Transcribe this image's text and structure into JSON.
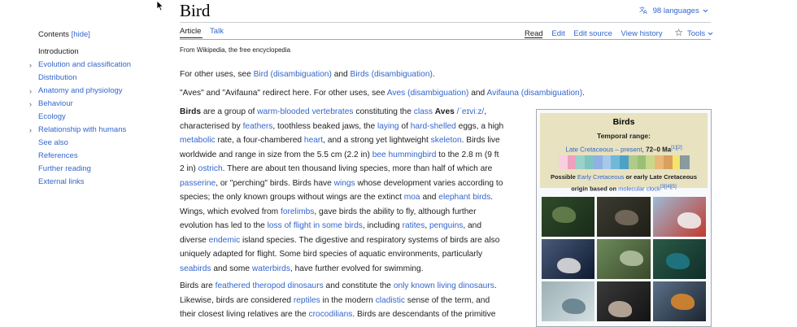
{
  "toc": {
    "header": "Contents",
    "hide": "[hide]",
    "items": [
      {
        "label": "Introduction",
        "current": true,
        "expand": false
      },
      {
        "label": "Evolution and classification",
        "current": false,
        "expand": true
      },
      {
        "label": "Distribution",
        "current": false,
        "expand": false
      },
      {
        "label": "Anatomy and physiology",
        "current": false,
        "expand": true
      },
      {
        "label": "Behaviour",
        "current": false,
        "expand": true
      },
      {
        "label": "Ecology",
        "current": false,
        "expand": false
      },
      {
        "label": "Relationship with humans",
        "current": false,
        "expand": true
      },
      {
        "label": "See also",
        "current": false,
        "expand": false
      },
      {
        "label": "References",
        "current": false,
        "expand": false
      },
      {
        "label": "Further reading",
        "current": false,
        "expand": false
      },
      {
        "label": "External links",
        "current": false,
        "expand": false
      }
    ]
  },
  "page": {
    "title": "Bird",
    "languages": "98 languages",
    "tabs_left": [
      "Article",
      "Talk"
    ],
    "tabs_right": [
      "Read",
      "Edit",
      "Edit source",
      "View history"
    ],
    "tools": "Tools",
    "tagline": "From Wikipedia, the free encyclopedia"
  },
  "hatnotes": {
    "h1": {
      "a": "For other uses, see ",
      "l1": "Bird (disambiguation)",
      "b": " and ",
      "l2": "Birds (disambiguation)",
      "c": "."
    },
    "h2": {
      "a": "\"Aves\" and \"Avifauna\" redirect here. For other uses, see ",
      "l1": "Aves (disambiguation)",
      "b": " and ",
      "l2": "Avifauna (disambiguation)",
      "c": "."
    }
  },
  "lead_lines": [
    [
      {
        "t": "Birds",
        "s": "b"
      },
      {
        "t": " are a group of "
      },
      {
        "t": "warm-blooded",
        "s": "l"
      },
      {
        "t": " "
      },
      {
        "t": "vertebrates",
        "s": "l"
      },
      {
        "t": " constituting the "
      },
      {
        "t": "class",
        "s": "l"
      },
      {
        "t": " "
      },
      {
        "t": "Aves",
        "s": "b"
      },
      {
        "t": " "
      },
      {
        "t": "/ˈeɪviːz/",
        "s": "l"
      },
      {
        "t": ","
      }
    ],
    [
      {
        "t": "characterised by "
      },
      {
        "t": "feathers",
        "s": "l"
      },
      {
        "t": ", toothless beaked jaws, the "
      },
      {
        "t": "laying",
        "s": "l"
      },
      {
        "t": " of "
      },
      {
        "t": "hard-shelled",
        "s": "l"
      },
      {
        "t": " eggs, a high"
      }
    ],
    [
      {
        "t": "metabolic",
        "s": "l"
      },
      {
        "t": " rate, a four-chambered "
      },
      {
        "t": "heart",
        "s": "l"
      },
      {
        "t": ", and a strong yet lightweight "
      },
      {
        "t": "skeleton",
        "s": "l"
      },
      {
        "t": ". Birds live"
      }
    ],
    [
      {
        "t": "worldwide and range in size from the 5.5 cm (2.2 in) "
      },
      {
        "t": "bee hummingbird",
        "s": "l"
      },
      {
        "t": " to the 2.8 m (9 ft"
      }
    ],
    [
      {
        "t": "2 in) "
      },
      {
        "t": "ostrich",
        "s": "l"
      },
      {
        "t": ". There are about ten thousand living species, more than half of which are"
      }
    ],
    [
      {
        "t": "passerine",
        "s": "l"
      },
      {
        "t": ", or \"perching\" birds. Birds have "
      },
      {
        "t": "wings",
        "s": "l"
      },
      {
        "t": " whose development varies according to"
      }
    ],
    [
      {
        "t": "species; the only known groups without wings are the extinct "
      },
      {
        "t": "moa",
        "s": "l"
      },
      {
        "t": " and "
      },
      {
        "t": "elephant birds",
        "s": "l"
      },
      {
        "t": "."
      }
    ],
    [
      {
        "t": "Wings, which evolved from "
      },
      {
        "t": "forelimbs",
        "s": "l"
      },
      {
        "t": ", gave birds the ability to fly, although further"
      }
    ],
    [
      {
        "t": "evolution has led to the "
      },
      {
        "t": "loss of flight in some birds",
        "s": "l"
      },
      {
        "t": ", including "
      },
      {
        "t": "ratites",
        "s": "l"
      },
      {
        "t": ", "
      },
      {
        "t": "penguins",
        "s": "l"
      },
      {
        "t": ", and"
      }
    ],
    [
      {
        "t": "diverse "
      },
      {
        "t": "endemic",
        "s": "l"
      },
      {
        "t": " island species. The digestive and respiratory systems of birds are also"
      }
    ],
    [
      {
        "t": "uniquely adapted for flight. Some bird species of aquatic environments, particularly"
      }
    ],
    [
      {
        "t": "seabirds",
        "s": "l"
      },
      {
        "t": " and some "
      },
      {
        "t": "waterbirds",
        "s": "l"
      },
      {
        "t": ", have further evolved for swimming."
      }
    ]
  ],
  "second_lines": [
    [
      {
        "t": "Birds are "
      },
      {
        "t": "feathered theropod dinosaurs",
        "s": "l"
      },
      {
        "t": " and constitute the "
      },
      {
        "t": "only known living dinosaurs",
        "s": "l"
      },
      {
        "t": "."
      }
    ],
    [
      {
        "t": "Likewise, birds are considered "
      },
      {
        "t": "reptiles",
        "s": "l"
      },
      {
        "t": " in the modern "
      },
      {
        "t": "cladistic",
        "s": "l"
      },
      {
        "t": " sense of the term, and"
      }
    ],
    [
      {
        "t": "their closest living relatives are the "
      },
      {
        "t": "crocodilians",
        "s": "l"
      },
      {
        "t": ". Birds are descendants of the primitive"
      }
    ]
  ],
  "infobox": {
    "title": "Birds",
    "range_label": "Temporal range:",
    "range_link": "Late Cretaceous – present",
    "range_sep": ", ",
    "range_value": "72–0 Ma",
    "range_refs": "[1][2]",
    "note_a": "Possible ",
    "note_link1": "Early Cretaceous",
    "note_b": " or early Late Cretaceous",
    "note_c": "origin based on ",
    "note_link2": "molecular clock",
    "note_refs": "[3][4][5]",
    "timeline_colors": [
      "#f7cfdf",
      "#f0a0bf",
      "#9ad1c8",
      "#7ec5c0",
      "#8fb1e3",
      "#a8c8ea",
      "#6fb8d8",
      "#4ea1c4",
      "#b1c98a",
      "#9ac076",
      "#c8d88a",
      "#e8b878",
      "#d9a060",
      "#f4e46a",
      "#fff3a0"
    ],
    "photo_colors": [
      [
        "#2f4b2a",
        "#6a8450",
        "#1a2b18"
      ],
      [
        "#3b3b30",
        "#7a7060",
        "#1f1f18"
      ],
      [
        "#9dbad6",
        "#f5f5f5",
        "#c23a2c"
      ],
      [
        "#4a5a78",
        "#e6e6e6",
        "#0d1a30"
      ],
      [
        "#6d8a5a",
        "#b7c6a6",
        "#3a4a2c"
      ],
      [
        "#2b5a46",
        "#1e7a8a",
        "#0f2e2a"
      ],
      [
        "#9cb0b6",
        "#5e7b88",
        "#d4e0e2"
      ],
      [
        "#3a3a3a",
        "#c9b8a6",
        "#131313"
      ],
      [
        "#5b7088",
        "#e08a2a",
        "#1c2530"
      ]
    ]
  },
  "colors": {
    "link": "#3366cc",
    "text": "#202122"
  }
}
